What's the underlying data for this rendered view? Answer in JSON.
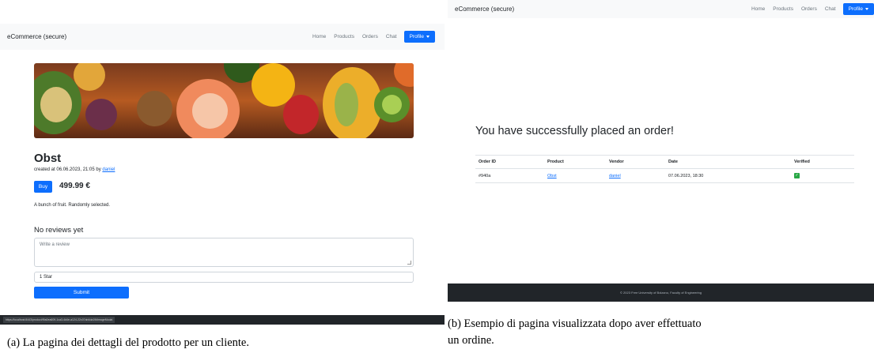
{
  "panel_a": {
    "nav": {
      "brand": "eCommerce (secure)",
      "links": [
        "Home",
        "Products",
        "Orders",
        "Chat"
      ],
      "profile": "Profile"
    },
    "product": {
      "title": "Obst",
      "created_prefix": "created at 06.06.2023, 21:05 by ",
      "author": "daniel",
      "buy_label": "Buy",
      "price": "499.99 €",
      "description": "A bunch of fruit. Randomly selected."
    },
    "reviews": {
      "heading": "No reviews yet",
      "placeholder": "Write a review",
      "rating_selected": "1 Star",
      "submit_label": "Submit"
    },
    "status_url": "https://localhost:8443/product/f9a0ea609-1ca3-4d4e-a124-22c07ab4da19#imageModal"
  },
  "panel_b": {
    "nav": {
      "brand": "eCommerce (secure)",
      "links": [
        "Home",
        "Products",
        "Orders",
        "Chat"
      ],
      "profile": "Profile"
    },
    "success_message": "You have successfully placed an order!",
    "table": {
      "headers": [
        "Order ID",
        "Product",
        "Vendor",
        "Date",
        "Verified"
      ],
      "row": {
        "order_id": "#940a",
        "product": "Obst",
        "vendor": "daniel",
        "date": "07.06.2023, 18:30",
        "verified": "✓"
      }
    },
    "footer": "© 2023 Free University of Bolzano, Faculty of Engineering"
  },
  "captions": {
    "a": "(a) La pagina dei dettagli del prodotto per un cliente.",
    "b_line1": "(b) Esempio di pagina visualizzata dopo aver effettuato",
    "b_line2": "un ordine."
  },
  "colors": {
    "primary": "#0d6efd",
    "navbar_bg": "#f8f9fa",
    "footer_bg": "#212529",
    "verified_green": "#28a745"
  }
}
